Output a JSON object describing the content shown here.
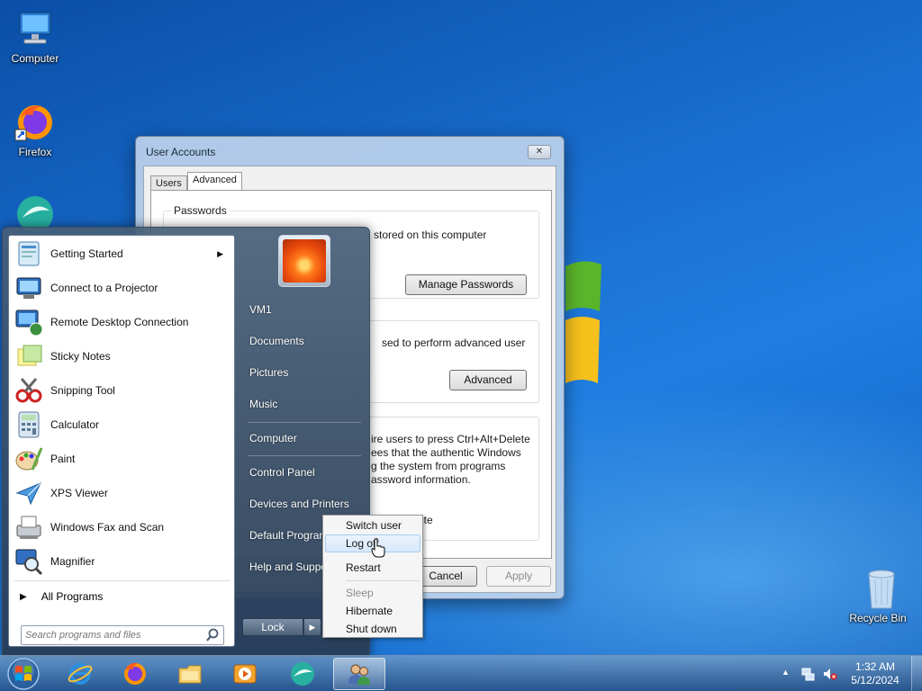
{
  "desktop": {
    "icons": [
      {
        "label": "Computer",
        "icon": "computer-icon"
      },
      {
        "label": "Firefox",
        "icon": "firefox-icon"
      },
      {
        "label": "Recycle Bin",
        "icon": "recycle-bin-icon"
      }
    ]
  },
  "window": {
    "title": "User Accounts",
    "tabs": [
      {
        "label": "Users"
      },
      {
        "label": "Advanced"
      }
    ],
    "active_tab": "Advanced",
    "passwords_group_label": "Passwords",
    "passwords_text": "stored on this computer",
    "manage_passwords_button": "Manage Passwords",
    "advanced_text": "sed to perform advanced user",
    "advanced_button": "Advanced",
    "secure_logon_text": [
      "ire users to press Ctrl+Alt+Delete",
      "ees that the authentic Windows",
      "g the system from programs",
      "assword information."
    ],
    "secure_logon_fragment": "Delete",
    "cancel_button": "Cancel",
    "apply_button": "Apply"
  },
  "start_menu": {
    "programs": [
      {
        "label": "Getting Started",
        "icon": "getting-started-icon",
        "has_submenu": true
      },
      {
        "label": "Connect to a Projector",
        "icon": "projector-icon"
      },
      {
        "label": "Remote Desktop Connection",
        "icon": "remote-desktop-icon"
      },
      {
        "label": "Sticky Notes",
        "icon": "sticky-notes-icon"
      },
      {
        "label": "Snipping Tool",
        "icon": "snipping-tool-icon"
      },
      {
        "label": "Calculator",
        "icon": "calculator-icon"
      },
      {
        "label": "Paint",
        "icon": "paint-icon"
      },
      {
        "label": "XPS Viewer",
        "icon": "xps-viewer-icon"
      },
      {
        "label": "Windows Fax and Scan",
        "icon": "fax-scan-icon"
      },
      {
        "label": "Magnifier",
        "icon": "magnifier-icon"
      }
    ],
    "all_programs": "All Programs",
    "search_placeholder": "Search programs and files",
    "right_items": [
      {
        "label": "VM1"
      },
      {
        "label": "Documents"
      },
      {
        "label": "Pictures"
      },
      {
        "label": "Music"
      },
      {
        "label": "Computer"
      },
      {
        "label": "Control Panel"
      },
      {
        "label": "Devices and Printers"
      },
      {
        "label": "Default Programs"
      },
      {
        "label": "Help and Support"
      }
    ],
    "lock_button": "Lock"
  },
  "power_menu": {
    "items": [
      {
        "label": "Switch user",
        "state": "normal"
      },
      {
        "label": "Log off",
        "state": "hover"
      },
      {
        "label": "Restart",
        "state": "normal"
      },
      {
        "label": "Sleep",
        "state": "disabled"
      },
      {
        "label": "Hibernate",
        "state": "normal"
      },
      {
        "label": "Shut down",
        "state": "normal"
      }
    ]
  },
  "taskbar": {
    "pinned": [
      {
        "name": "internet-explorer-icon"
      },
      {
        "name": "firefox-icon"
      },
      {
        "name": "file-explorer-icon"
      },
      {
        "name": "media-player-icon"
      },
      {
        "name": "app-icon"
      },
      {
        "name": "user-accounts-icon",
        "active": true
      }
    ],
    "clock_time": "1:32 AM",
    "clock_date": "5/12/2024"
  }
}
